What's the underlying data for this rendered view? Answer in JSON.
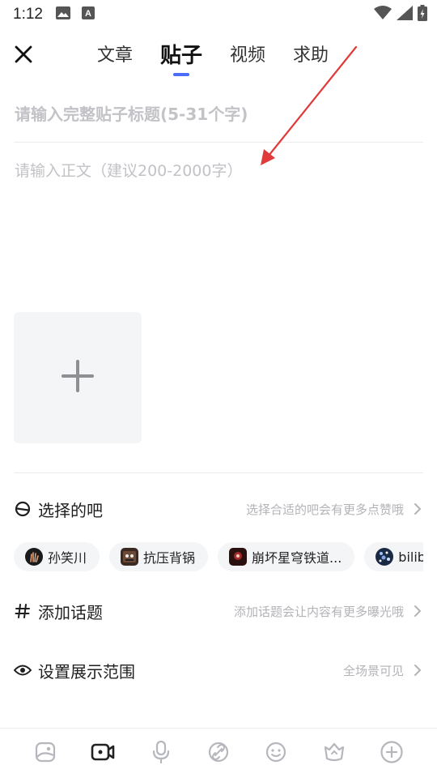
{
  "status_bar": {
    "time": "1:12",
    "left_icons": [
      "image-icon",
      "text-a-icon"
    ],
    "right_icons": [
      "wifi-icon",
      "signal-icon",
      "battery-charging-icon"
    ]
  },
  "header": {
    "close_icon": "close-icon",
    "tabs": [
      {
        "label": "文章",
        "active": false
      },
      {
        "label": "贴子",
        "active": true
      },
      {
        "label": "视频",
        "active": false
      },
      {
        "label": "求助",
        "active": false
      }
    ],
    "accent_color": "#4a6cf7"
  },
  "editor": {
    "title_placeholder": "请输入完整贴子标题(5-31个字)",
    "body_placeholder": "请输入正文（建议200-2000字）",
    "add_media_icon": "plus-icon"
  },
  "select_bar": {
    "label": "选择的吧",
    "hint": "选择合适的吧会有更多点赞哦",
    "icon": "bar-circle-icon",
    "chips": [
      {
        "label": "孙笑川",
        "avatar_color": "#1a1a1a"
      },
      {
        "label": "抗压背锅",
        "avatar_color": "#3a2a22"
      },
      {
        "label": "崩坏星穹铁道...",
        "avatar_color": "#2b1010"
      },
      {
        "label": "bilibili",
        "avatar_color": "#1b2a44"
      }
    ]
  },
  "topic": {
    "label": "添加话题",
    "hint": "添加话题会让内容有更多曝光哦",
    "icon": "hash-icon"
  },
  "visibility": {
    "label": "设置展示范围",
    "hint": "全场景可见",
    "icon": "eye-icon"
  },
  "toolbar": {
    "items": [
      "image-icon",
      "video-icon",
      "microphone-icon",
      "link-icon",
      "emoji-icon",
      "badge-icon",
      "plus-circle-icon"
    ]
  },
  "annotation": {
    "arrow_color": "#e03a3a"
  }
}
